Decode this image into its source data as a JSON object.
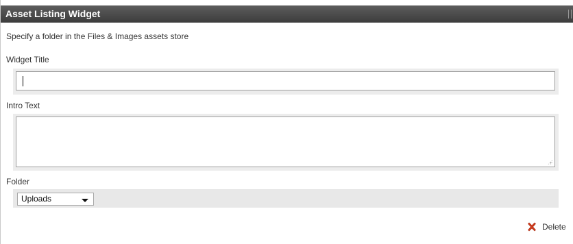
{
  "widget": {
    "title": "Asset Listing Widget",
    "instructions": "Specify a folder in the Files & Images assets store"
  },
  "fields": {
    "widget_title": {
      "label": "Widget Title",
      "value": ""
    },
    "intro_text": {
      "label": "Intro Text",
      "value": ""
    },
    "folder": {
      "label": "Folder",
      "selected": "Uploads"
    }
  },
  "actions": {
    "delete_label": "Delete",
    "delete_icon": "close-x-icon"
  },
  "colors": {
    "header_bg": "#4a4a4a",
    "field_panel_bg": "#ececec",
    "delete_icon": "#d23b1c"
  }
}
